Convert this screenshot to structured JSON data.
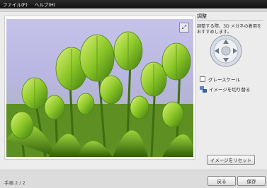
{
  "menu": {
    "file": "ファイル(F)",
    "help": "ヘルプ(H)"
  },
  "panel": {
    "title": "調整",
    "description": "調整する際、3D メガネの着用をおすすめします。",
    "grayscale_label": "グレースケール",
    "switch_image_label": "イメージを切り替る",
    "reset_button": "イメージをリセット",
    "grayscale_checked": false
  },
  "footer": {
    "step": "手順 2 / 2",
    "back_button": "戻る",
    "save_button": "保存"
  },
  "icons": {
    "expand": "expand-icon",
    "direction_pad": "direction-pad-icon",
    "switch": "swap-images-icon"
  },
  "colors": {
    "menubar": "#1a1a1a",
    "tulip_green": "#7fc42a",
    "sky": "#c4c1ea"
  }
}
